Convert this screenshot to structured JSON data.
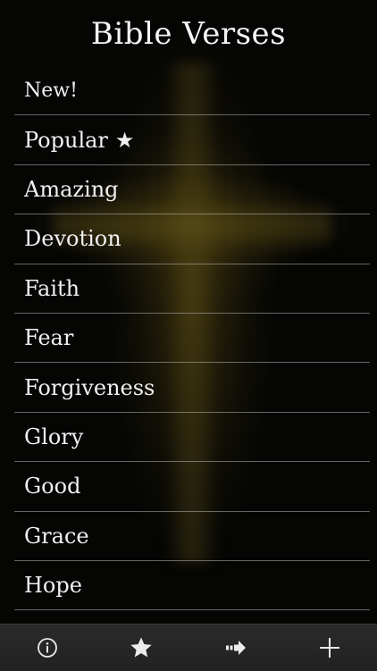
{
  "app": {
    "title": "Bible Verses"
  },
  "categories": [
    {
      "label": "New!"
    },
    {
      "label": "Popular",
      "icon": "star-icon",
      "icon_glyph": "★"
    },
    {
      "label": "Amazing"
    },
    {
      "label": "Devotion"
    },
    {
      "label": "Faith"
    },
    {
      "label": "Fear"
    },
    {
      "label": "Forgiveness"
    },
    {
      "label": "Glory"
    },
    {
      "label": "Good"
    },
    {
      "label": "Grace"
    },
    {
      "label": "Hope"
    }
  ],
  "toolbar": {
    "items": [
      {
        "icon": "info-icon"
      },
      {
        "icon": "favorites-star-icon"
      },
      {
        "icon": "share-arrow-icon"
      },
      {
        "icon": "add-icon"
      }
    ]
  },
  "colors": {
    "background": "#000000",
    "text": "#f2f2f2",
    "separator": "#b4b4b4",
    "toolbar": "#262626",
    "cross_glow": "#5a4b12"
  }
}
